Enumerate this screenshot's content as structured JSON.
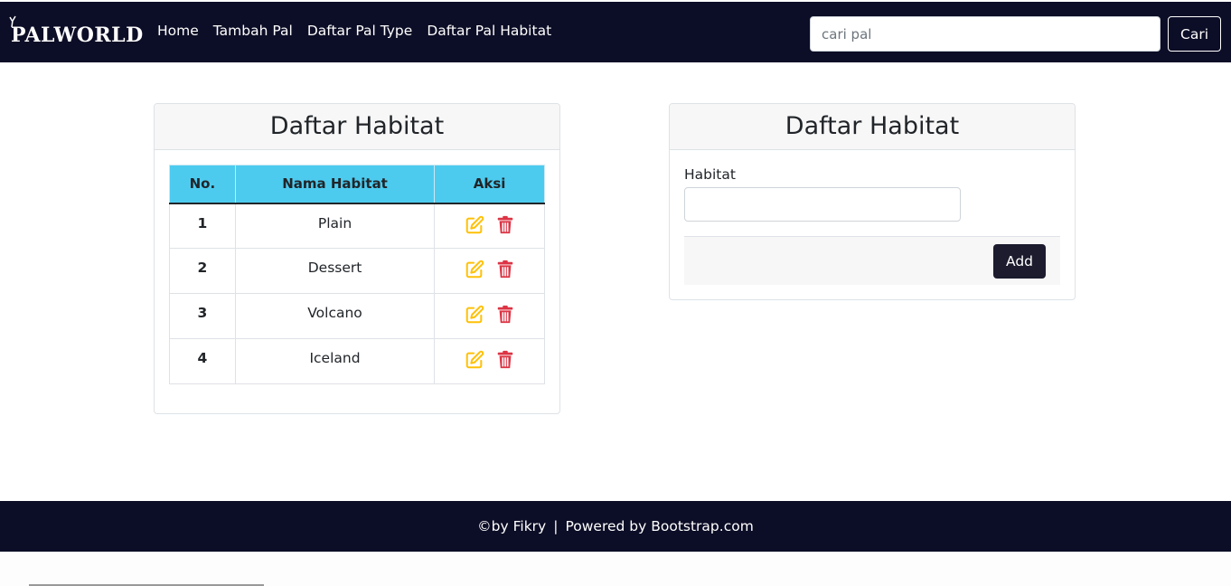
{
  "navbar": {
    "brand": "PALWORLD",
    "links": [
      "Home",
      "Tambah Pal",
      "Daftar Pal Type",
      "Daftar Pal Habitat"
    ],
    "search_placeholder": "cari pal",
    "search_button": "Cari"
  },
  "list_card": {
    "title": "Daftar Habitat",
    "columns": [
      "No.",
      "Nama Habitat",
      "Aksi"
    ],
    "rows": [
      {
        "no": "1",
        "name": "Plain"
      },
      {
        "no": "2",
        "name": "Dessert"
      },
      {
        "no": "3",
        "name": "Volcano"
      },
      {
        "no": "4",
        "name": "Iceland"
      }
    ],
    "edit_icon": "edit-icon",
    "delete_icon": "trash-icon",
    "edit_color": "#ffc107",
    "delete_color": "#dc3545"
  },
  "form_card": {
    "title": "Daftar Habitat",
    "field_label": "Habitat",
    "field_value": "",
    "add_button": "Add"
  },
  "footer": {
    "credit": "©by Fikry",
    "separator": "|",
    "powered": "Powered by Bootstrap.com"
  },
  "colors": {
    "navbar_bg": "#0c0d26",
    "table_header_bg": "#4dcbef",
    "button_dark": "#1c1c2e"
  }
}
